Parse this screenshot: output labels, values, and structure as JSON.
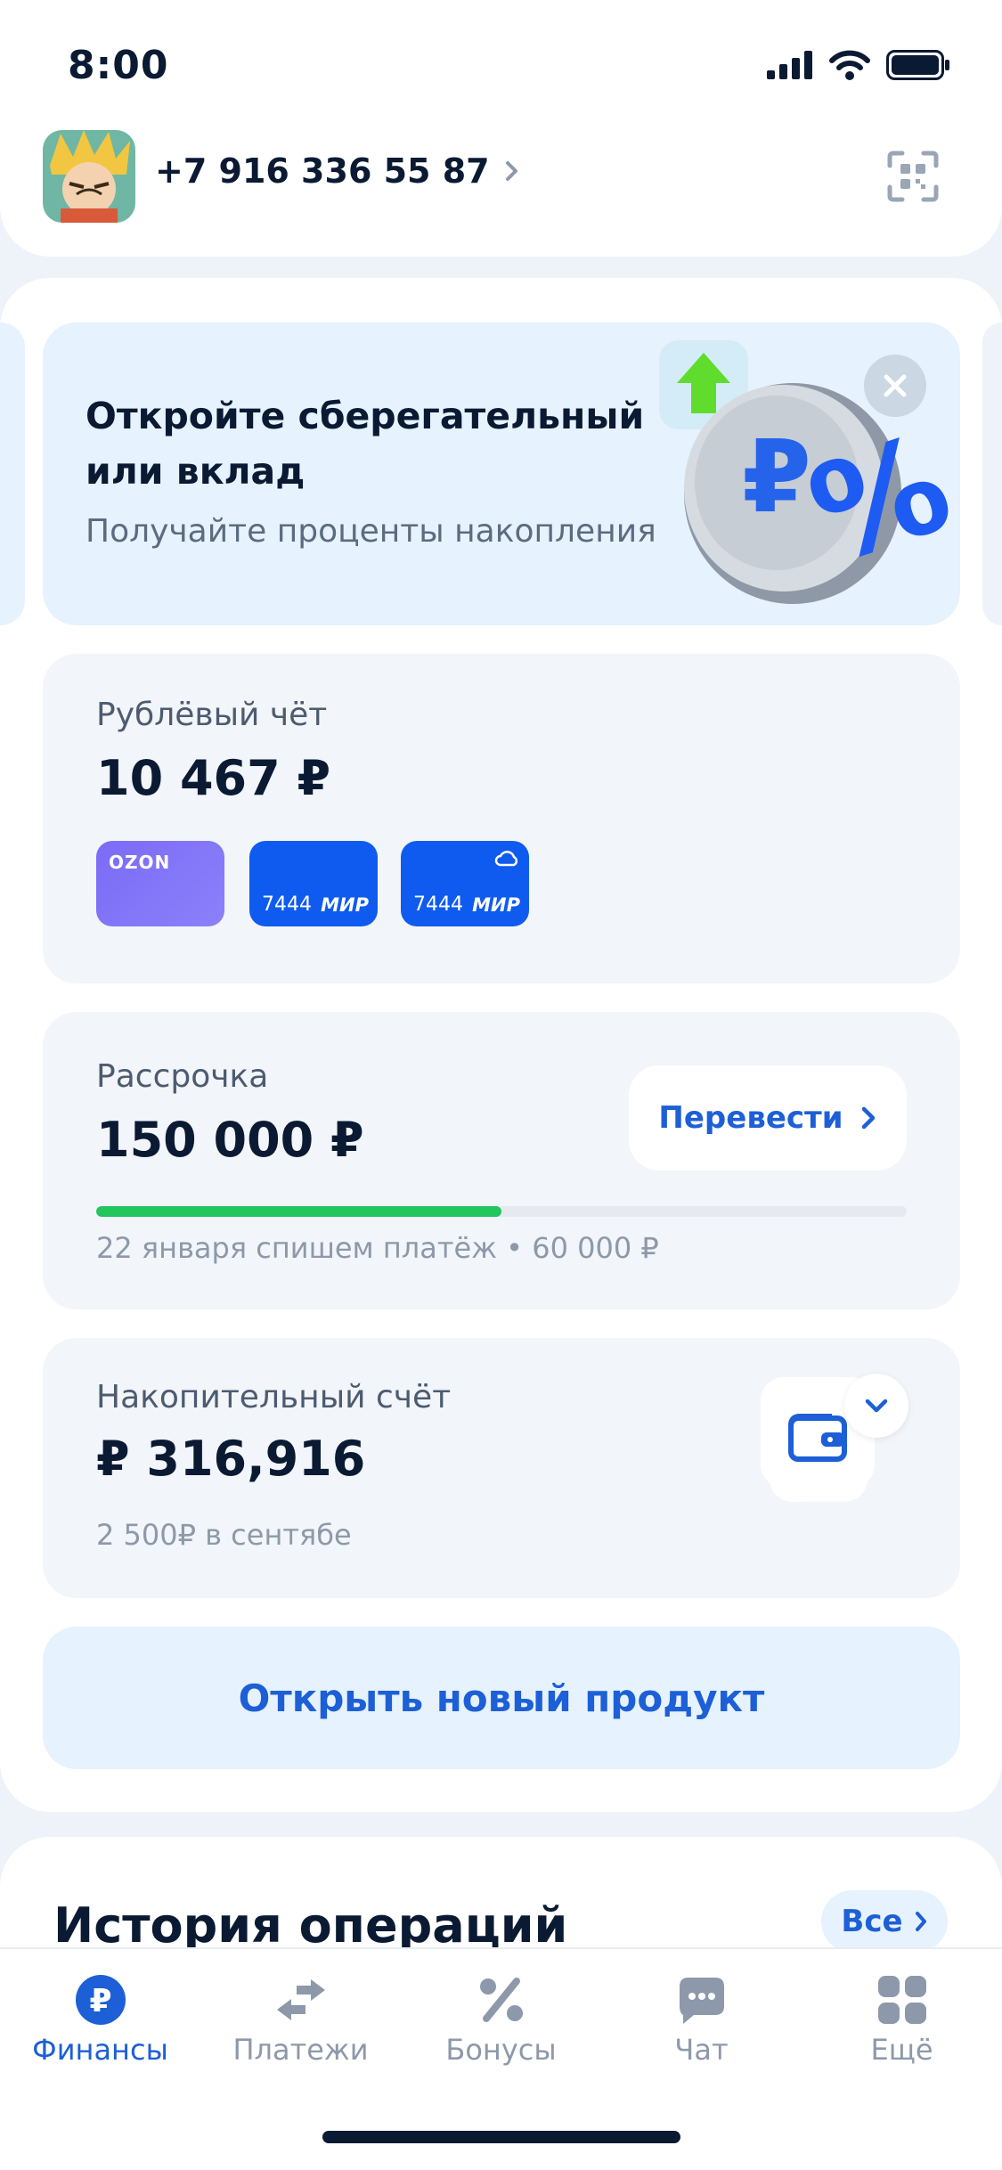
{
  "status_bar": {
    "time": "8:00"
  },
  "header": {
    "phone": "+7 916 336 55 87"
  },
  "promo": {
    "title": "Откройте сберегательный или вклад",
    "subtitle": "Получайте проценты накопления"
  },
  "ruble_account": {
    "label": "Рублёвый чёт",
    "amount": "10 467 ₽",
    "cards": [
      {
        "brand": "OZON",
        "number": "",
        "system": ""
      },
      {
        "brand": "",
        "number": "7444",
        "system": "МИР"
      },
      {
        "brand": "",
        "number": "7444",
        "system": "МИР"
      }
    ]
  },
  "installment": {
    "label": "Рассрочка",
    "amount": "150 000 ₽",
    "transfer_label": "Перевести",
    "progress": 0.5,
    "note": "22 января спишем платёж • 60 000 ₽"
  },
  "savings": {
    "label": "Накопительный счёт",
    "amount": "₽ 316,916",
    "note": "2 500₽ в сентябе"
  },
  "open_new_label": "Открыть новый продукт",
  "history": {
    "title": "История операций",
    "all_label": "Все"
  },
  "tabbar": [
    {
      "label": "Финансы",
      "icon": "ruble-icon",
      "active": true
    },
    {
      "label": "Платежи",
      "icon": "transfer-arrows-icon",
      "active": false
    },
    {
      "label": "Бонусы",
      "icon": "percent-icon",
      "active": false
    },
    {
      "label": "Чат",
      "icon": "chat-icon",
      "active": false
    },
    {
      "label": "Ещё",
      "icon": "grid-icon",
      "active": false
    }
  ],
  "colors": {
    "accent": "#1d5fd6",
    "progress": "#22c55e",
    "ozon_card": "#7a6cf5",
    "mir_card": "#0f5bf0"
  }
}
